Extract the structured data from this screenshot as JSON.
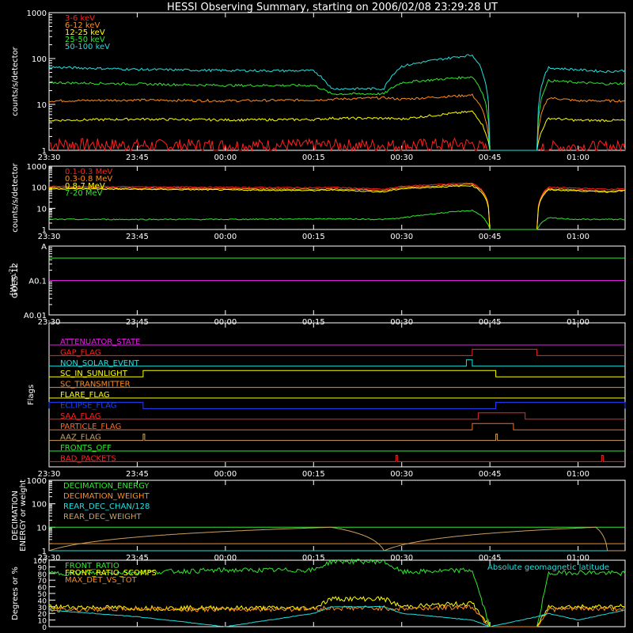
{
  "title": "HESSI Observing Summary, starting on 2006/02/08 23:29:28 UT",
  "colors": {
    "white": "#ffffff",
    "red": "#ff2020",
    "orange": "#ff8c1a",
    "yellow": "#ffff00",
    "green": "#2fe82f",
    "cyan": "#20e0e0",
    "magenta": "#e020e0",
    "blue": "#2040ff",
    "darkorange": "#ff6a20",
    "olive": "#c8a060"
  },
  "time_ticks": [
    "23:30",
    "23:45",
    "00:00",
    "00:15",
    "00:30",
    "00:45",
    "01:00"
  ],
  "chart_data": [
    {
      "type": "line",
      "panel": "count-rates",
      "ylabel": "counts/s/detector",
      "yscale": "log",
      "ylim": [
        1,
        1000
      ],
      "yticks": [
        "1",
        "10",
        "100",
        "1000"
      ],
      "x": [
        "23:30",
        "23:45",
        "00:00",
        "00:15",
        "00:18",
        "00:27",
        "00:30",
        "00:42",
        "00:45",
        "00:53",
        "00:55",
        "01:00",
        "01:05",
        "01:08"
      ],
      "series": [
        {
          "name": "3-6 keV",
          "color": "#ff2020",
          "values": [
            1.4,
            1.3,
            1.3,
            1.3,
            1.3,
            1.3,
            1.3,
            1.4,
            1,
            1,
            1.2,
            1.2,
            1.2,
            1.2
          ]
        },
        {
          "name": "6-12 keV",
          "color": "#ff8c1a",
          "values": [
            12,
            12.5,
            12,
            12.5,
            13,
            14,
            13,
            16,
            1,
            1,
            14,
            12,
            12,
            12
          ]
        },
        {
          "name": "12-25 keV",
          "color": "#ffff00",
          "values": [
            4.5,
            4.8,
            4.6,
            4.7,
            5,
            5,
            4.8,
            7,
            1,
            1,
            5,
            4.5,
            4.5,
            4.5
          ]
        },
        {
          "name": "25-50 keV",
          "color": "#2fe82f",
          "values": [
            30,
            28,
            26,
            26,
            17,
            17,
            30,
            40,
            1,
            1,
            33,
            30,
            28,
            29
          ]
        },
        {
          "name": "50-100 keV",
          "color": "#20e0e0",
          "values": [
            65,
            58,
            55,
            54,
            22,
            22,
            68,
            120,
            1,
            1,
            63,
            57,
            52,
            55
          ]
        }
      ]
    },
    {
      "type": "line",
      "panel": "high-energy-rates",
      "ylabel": "counts/s/detector",
      "yscale": "log",
      "ylim": [
        1,
        1000
      ],
      "yticks": [
        "1",
        "10",
        "100",
        "1000"
      ],
      "x": [
        "23:30",
        "23:45",
        "00:00",
        "00:15",
        "00:18",
        "00:27",
        "00:30",
        "00:42",
        "00:45",
        "00:53",
        "00:55",
        "01:00",
        "01:05",
        "01:08"
      ],
      "series": [
        {
          "name": "0.1-0.3 MeV",
          "color": "#ff2020",
          "values": [
            110,
            105,
            100,
            95,
            100,
            80,
            110,
            160,
            1,
            1,
            100,
            90,
            80,
            90
          ]
        },
        {
          "name": "0.3-0.8 MeV",
          "color": "#ff8c1a",
          "values": [
            95,
            90,
            85,
            80,
            85,
            70,
            95,
            140,
            1,
            1,
            85,
            75,
            65,
            75
          ]
        },
        {
          "name": "0.8-7 MeV",
          "color": "#ffff00",
          "values": [
            85,
            80,
            75,
            70,
            75,
            60,
            85,
            120,
            1,
            1,
            75,
            68,
            60,
            70
          ]
        },
        {
          "name": "7-20 MeV",
          "color": "#2fe82f",
          "values": [
            3,
            3,
            3,
            3.2,
            3.2,
            3,
            3.5,
            8,
            1,
            1,
            3.5,
            3,
            3,
            3
          ]
        }
      ]
    },
    {
      "type": "line",
      "panel": "goes",
      "ylabel": "GOES-12",
      "yunit": "[W m",
      "yunit_tail": "]",
      "yunit_sup": "-2",
      "yscale": "log",
      "ylim": [
        0.01,
        1
      ],
      "yticks": [
        "A0.01",
        "A0.1",
        "A"
      ],
      "x": [
        "23:30",
        "01:08"
      ],
      "series": [
        {
          "name": "long",
          "color": "#2fe82f",
          "values": [
            0.45,
            0.45
          ]
        },
        {
          "name": "short",
          "color": "#e020e0",
          "values": [
            0.1,
            0.1
          ]
        }
      ]
    },
    {
      "type": "line",
      "panel": "flags",
      "ylabel": "Flags",
      "flags": [
        {
          "name": "ATTENUATOR_STATE",
          "color": "#e020e0",
          "on": []
        },
        {
          "name": "GAP_FLAG",
          "color": "#ff2020",
          "on": [
            [
              "00:42",
              "00:53"
            ]
          ]
        },
        {
          "name": "NON_SOLAR_EVENT",
          "color": "#20e0e0",
          "on": [
            [
              "00:41",
              "00:42"
            ]
          ]
        },
        {
          "name": "SC_IN_SUNLIGHT",
          "color": "#ffff00",
          "on": [
            [
              "23:46",
              "00:46"
            ]
          ]
        },
        {
          "name": "SC_TRANSMITTER",
          "color": "#ff8c1a",
          "on": []
        },
        {
          "name": "FLARE_FLAG",
          "color": "#ffff00",
          "on": []
        },
        {
          "name": "ECLIPSE_FLAG",
          "color": "#2040ff",
          "on": [
            [
              "23:30",
              "23:46"
            ],
            [
              "00:46",
              "01:08"
            ]
          ]
        },
        {
          "name": "SAA_FLAG",
          "color": "#ff2020",
          "on": [
            [
              "00:43",
              "00:51"
            ]
          ]
        },
        {
          "name": "PARTICLE_FLAG",
          "color": "#ff6a20",
          "on": [
            [
              "00:42",
              "00:49"
            ]
          ]
        },
        {
          "name": "AAZ_FLAG",
          "color": "#c8a060",
          "on": [
            [
              "23:46",
              "23:46"
            ],
            [
              "00:46",
              "00:46"
            ]
          ]
        },
        {
          "name": "FRONTS_OFF",
          "color": "#2fe82f",
          "on": []
        },
        {
          "name": "BAD_PACKETS",
          "color": "#ff2020",
          "on": [
            [
              "00:29",
              "00:29"
            ],
            [
              "01:04",
              "01:04"
            ]
          ]
        }
      ]
    },
    {
      "type": "line",
      "panel": "decimation",
      "ylabel": "DECIMATION",
      "ylabel2": "ENERGY or weight",
      "yscale": "log",
      "ylim": [
        1,
        1000
      ],
      "yticks": [
        "1",
        "10",
        "100",
        "1000"
      ],
      "x": [
        "23:30",
        "00:18",
        "00:27",
        "01:03",
        "01:05",
        "01:08"
      ],
      "series": [
        {
          "name": "DECIMATION_ENERGY",
          "color": "#2fe82f",
          "values": [
            10,
            10,
            10,
            10,
            10,
            10
          ]
        },
        {
          "name": "DECIMATION_WEIGHT",
          "color": "#ff8c1a",
          "values": [
            2,
            2,
            2,
            2,
            2,
            2
          ]
        },
        {
          "name": "REAR_DEC_CHAN/128",
          "color": "#20e0e0",
          "values": [
            1,
            1,
            1,
            1,
            1,
            1
          ]
        },
        {
          "name": "REAR_DEC_WEIGHT",
          "color": "#c8a060",
          "values": [
            1,
            10,
            1,
            10,
            1,
            1
          ]
        }
      ]
    },
    {
      "type": "line",
      "panel": "ratios",
      "ylabel": "Degrees or %",
      "ylim": [
        0,
        100
      ],
      "yticks": [
        "0",
        "10",
        "20",
        "30",
        "40",
        "50",
        "60",
        "70",
        "80",
        "90",
        "100"
      ],
      "annotation": "Absolute geomagnetic latitude",
      "x": [
        "23:30",
        "23:45",
        "00:00",
        "00:15",
        "00:18",
        "00:27",
        "00:30",
        "00:42",
        "00:45",
        "00:53",
        "00:55",
        "01:00",
        "01:08"
      ],
      "series": [
        {
          "name": "FRONT_RATIO",
          "color": "#2fe82f",
          "values": [
            80,
            82,
            85,
            85,
            98,
            98,
            82,
            85,
            0,
            0,
            80,
            82,
            80
          ]
        },
        {
          "name": "FRONT_RATIO_SCOMPS",
          "color": "#ffff00",
          "values": [
            30,
            28,
            28,
            28,
            42,
            42,
            30,
            35,
            0,
            0,
            30,
            30,
            30
          ]
        },
        {
          "name": "MAX_DET_VS_TOT",
          "color": "#ff8c1a",
          "values": [
            25,
            27,
            26,
            27,
            28,
            28,
            27,
            30,
            0,
            0,
            26,
            27,
            27
          ]
        },
        {
          "name": "Absolute geomagnetic latitude",
          "color": "#20e0e0",
          "values": [
            25,
            15,
            0,
            20,
            30,
            30,
            20,
            10,
            0,
            15,
            20,
            10,
            25
          ]
        }
      ]
    }
  ]
}
